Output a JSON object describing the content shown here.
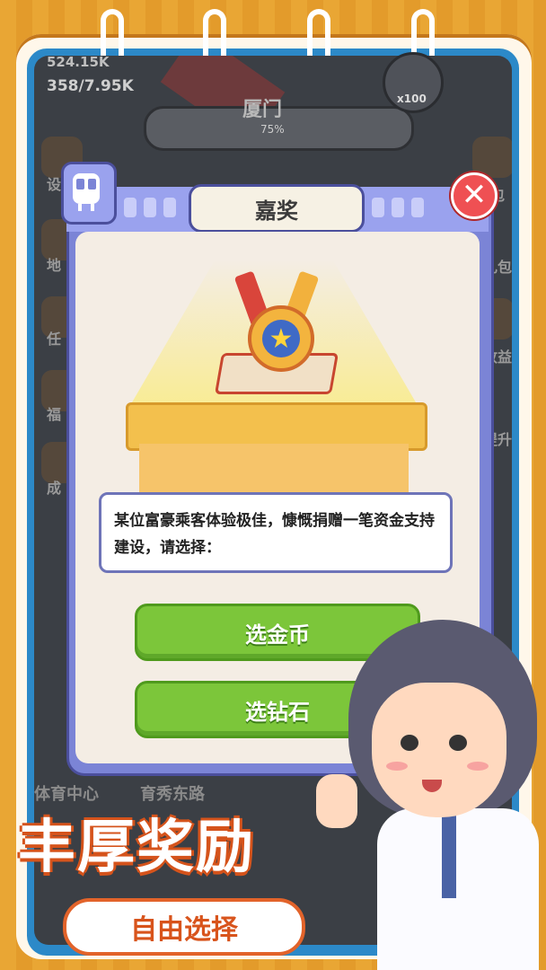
{
  "hud": {
    "stat_top": "524.15K",
    "stat_main": "358/7.95K",
    "station_name": "厦门",
    "station_progress": "75%",
    "gem_count": "x100"
  },
  "side_left": [
    "设",
    "地",
    "任",
    "福",
    "成"
  ],
  "side_right": [
    "包",
    "礼包",
    "收益",
    "提升"
  ],
  "bottom_hud": [
    "体育中心",
    "育秀东路"
  ],
  "modal": {
    "title": "嘉奖",
    "description": "某位富豪乘客体验极佳，慷慨捐赠一笔资金支持建设，请选择：",
    "option_gold": "选金币",
    "option_diamond": "选钻石",
    "close_symbol": "✕"
  },
  "banner": {
    "title": "丰厚奖励",
    "subtitle": "自由选择"
  },
  "icons": {
    "close": "close-icon",
    "train": "train-icon",
    "medal": "medal-icon",
    "star": "star-icon"
  },
  "colors": {
    "accent_green": "#7cc63a",
    "modal_purple": "#7b84d6",
    "close_red": "#ef5053",
    "banner_orange": "#e2632a"
  }
}
